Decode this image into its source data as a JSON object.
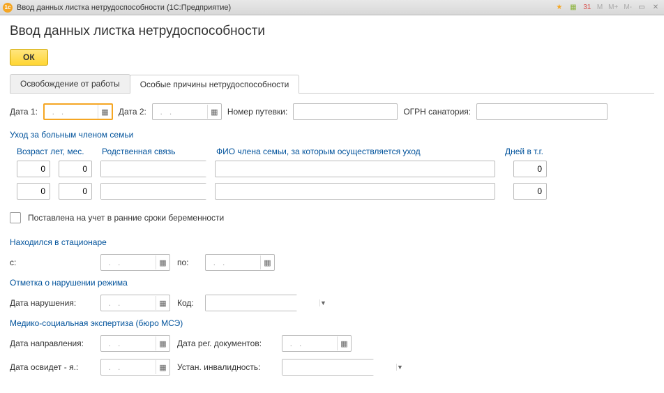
{
  "titlebar": {
    "title": "Ввод данных листка нетрудоспособности  (1С:Предприятие)",
    "m": "M",
    "mp": "M+",
    "mm": "M-"
  },
  "header": {
    "title": "Ввод данных листка нетрудоспособности",
    "ok": "ОК"
  },
  "tabs": {
    "t1": "Освобождение от работы",
    "t2": "Особые причины нетрудоспособности"
  },
  "form": {
    "date1_label": "Дата 1:",
    "date1_value": "  .   .   ",
    "date2_label": "Дата 2:",
    "date2_value": "  .   .   ",
    "voucher_label": "Номер путевки:",
    "voucher_value": "",
    "ogrn_label": "ОГРН санатория:",
    "ogrn_value": ""
  },
  "care": {
    "title": "Уход за больным членом семьи",
    "h_age": "Возраст лет, мес.",
    "h_rel": "Родственная связь",
    "h_fio": "ФИО члена семьи, за которым осуществляется уход",
    "h_days": "Дней в т.г.",
    "rows": [
      {
        "years": "0",
        "months": "0",
        "rel": "",
        "fio": "",
        "days": "0"
      },
      {
        "years": "0",
        "months": "0",
        "rel": "",
        "fio": "",
        "days": "0"
      }
    ]
  },
  "pregnancy": {
    "label": "Поставлена на учет в ранние сроки беременности"
  },
  "hospital": {
    "title": "Находился в стационаре",
    "from_label": "с:",
    "from_value": "  .   .   ",
    "to_label": "по:",
    "to_value": "  .   .   "
  },
  "violation": {
    "title": "Отметка о нарушении режима",
    "date_label": "Дата нарушения:",
    "date_value": "  .   .   ",
    "code_label": "Код:",
    "code_value": ""
  },
  "mse": {
    "title": "Медико-социальная экспертиза (бюро МСЭ)",
    "dir_label": "Дата направления:",
    "dir_value": "  .   .   ",
    "reg_label": "Дата рег. документов:",
    "reg_value": "  .   .   ",
    "exam_label": "Дата освидет - я.:",
    "exam_value": "  .   .   ",
    "disab_label": "Устан. инвалидность:",
    "disab_value": ""
  }
}
